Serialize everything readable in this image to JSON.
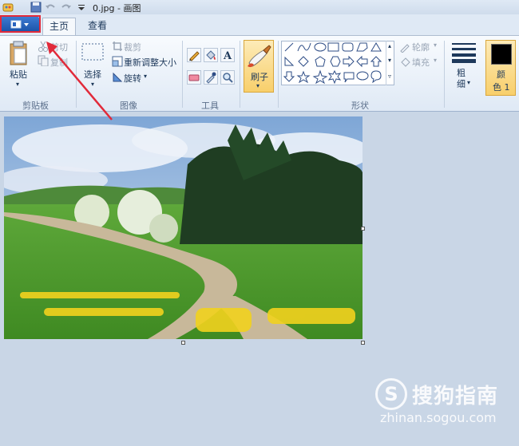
{
  "window": {
    "title": "0.jpg - 画图"
  },
  "tabs": {
    "home": "主页",
    "view": "查看"
  },
  "clipboard": {
    "paste": "粘贴",
    "cut": "剪切",
    "copy": "复制",
    "group": "剪贴板"
  },
  "image": {
    "select": "选择",
    "crop": "裁剪",
    "resize": "重新调整大小",
    "rotate": "旋转",
    "group": "图像"
  },
  "tools": {
    "group": "工具"
  },
  "brush": {
    "label": "刷子"
  },
  "shapes": {
    "outline": "轮廓",
    "fill": "填充",
    "group": "形状"
  },
  "size": {
    "label_line1": "粗",
    "label_line2": "细"
  },
  "color": {
    "label_line1": "颜",
    "label_line2": "色 1",
    "value": "#000000"
  },
  "watermark": {
    "logo": "S",
    "name": "搜狗指南",
    "url": "zhinan.sogou.com"
  },
  "colors": {
    "accent": "#e12a3a",
    "file_button": "#2a64bf"
  }
}
